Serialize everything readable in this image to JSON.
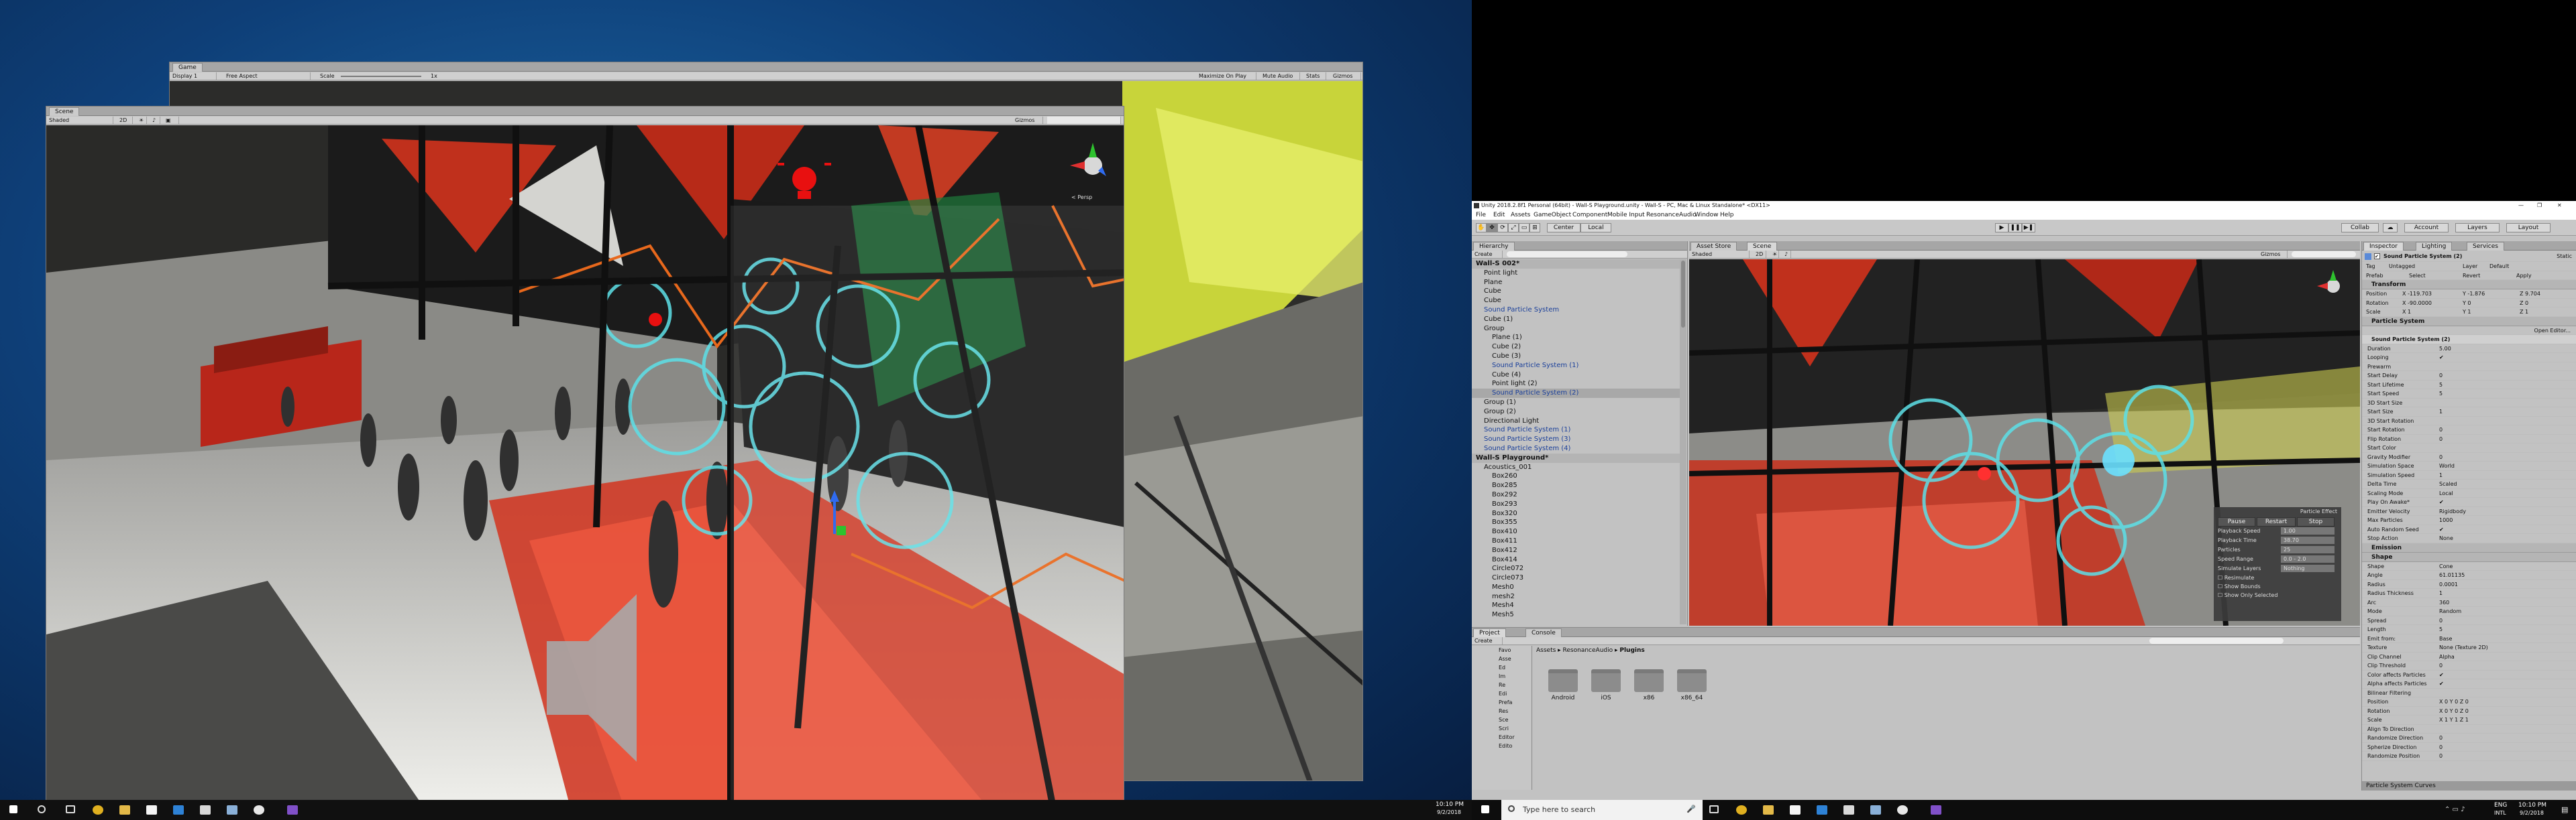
{
  "game_window": {
    "tab": "Game",
    "toolbar": {
      "display": "Display 1",
      "aspect": "Free Aspect",
      "scale_label": "Scale",
      "scale_value": "1x",
      "maximize": "Maximize On Play",
      "mute": "Mute Audio",
      "stats": "Stats",
      "gizmos": "Gizmos"
    }
  },
  "scene_window": {
    "tab": "Scene",
    "toolbar": {
      "shaded": "Shaded",
      "mode2d": "2D",
      "gizmos": "Gizmos"
    },
    "persp": "< Persp"
  },
  "unity": {
    "title": "Unity 2018.2.8f1 Personal (64bit) - Wall-S Playground.unity - Wall-S - PC, Mac & Linux Standalone* <DX11>",
    "menu": [
      "File",
      "Edit",
      "Assets",
      "GameObject",
      "Component",
      "Mobile Input",
      "ResonanceAudio",
      "Window",
      "Help"
    ],
    "toolbar": {
      "center": "Center",
      "local": "Local",
      "collab": "Collab",
      "account": "Account",
      "layers": "Layers",
      "layout": "Layout"
    },
    "hierarchy": {
      "tab": "Hierarchy",
      "create": "Create",
      "items": [
        "Wall-S 002*",
        "Point light",
        "Plane",
        "Cube",
        "Cube",
        "Sound Particle System",
        "Cube (1)",
        "Group",
        "Plane (1)",
        "Cube (2)",
        "Cube (3)",
        "Sound Particle System (1)",
        "Cube (4)",
        "Point light (2)",
        "Sound Particle System (2)",
        "Group (1)",
        "Group (2)",
        "Directional Light",
        "Sound Particle System (1)",
        "Sound Particle System (3)",
        "Sound Particle System (4)",
        "Wall-S Playground*",
        "Acoustics_001",
        "Box260",
        "Box285",
        "Box292",
        "Box293",
        "Box320",
        "Box355",
        "Box410",
        "Box411",
        "Box412",
        "Box414",
        "Circle072",
        "Circle073",
        "Mesh0",
        "mesh2",
        "Mesh4",
        "Mesh5"
      ]
    },
    "scene_tabs": [
      "Asset Store",
      "Scene"
    ],
    "scene_toolbar": {
      "shaded": "Shaded",
      "gizmos": "Gizmos"
    },
    "particle_effect": {
      "header": "Particle Effect",
      "buttons": [
        "Pause",
        "Restart",
        "Stop"
      ],
      "rows": [
        {
          "k": "Playback Speed",
          "v": "1.00"
        },
        {
          "k": "Playback Time",
          "v": "38.70"
        },
        {
          "k": "Particles",
          "v": "25"
        },
        {
          "k": "Speed Range",
          "v": "0.0 - 2.0"
        },
        {
          "k": "Simulate Layers",
          "v": "Nothing"
        }
      ],
      "checks": [
        "Resimulate",
        "Show Bounds",
        "Show Only Selected"
      ]
    },
    "project": {
      "tabs": [
        "Project",
        "Console"
      ],
      "create": "Create",
      "breadcrumb": [
        "Assets",
        "ResonanceAudio",
        "Plugins"
      ],
      "folders": [
        "Android",
        "iOS",
        "x86",
        "x86_64"
      ],
      "tree": [
        "Favo",
        "Asse",
        "Ed",
        "Im",
        "Re",
        "Edi",
        "Prefa",
        "Res",
        "Sce",
        "Scri",
        "Editor",
        "Edito"
      ]
    },
    "inspector": {
      "tabs": [
        "Inspector",
        "Lighting",
        "Services"
      ],
      "object_name": "Sound Particle System (2)",
      "static": "Static",
      "tag_label": "Tag",
      "tag": "Untagged",
      "layer_label": "Layer",
      "layer": "Default",
      "prefab": "Prefab",
      "select": "Select",
      "revert": "Revert",
      "apply": "Apply",
      "transform": {
        "header": "Transform",
        "position": "Position",
        "rotation": "Rotation",
        "scale": "Scale",
        "pos": [
          "X -119.703",
          "Y -1.876",
          "Z 9.704"
        ],
        "rot": [
          "X -90.0000",
          "Y 0",
          "Z 0"
        ],
        "scl": [
          "X 1",
          "Y 1",
          "Z 1"
        ]
      },
      "particle_system": {
        "header": "Particle System",
        "open_editor": "Open Editor...",
        "sub": "Sound Particle System (2)",
        "rows": [
          {
            "k": "Duration",
            "v": "5.00"
          },
          {
            "k": "Looping",
            "v": "✔"
          },
          {
            "k": "Prewarm",
            "v": ""
          },
          {
            "k": "Start Delay",
            "v": "0"
          },
          {
            "k": "Start Lifetime",
            "v": "5"
          },
          {
            "k": "Start Speed",
            "v": "5"
          },
          {
            "k": "3D Start Size",
            "v": ""
          },
          {
            "k": "Start Size",
            "v": "1"
          },
          {
            "k": "3D Start Rotation",
            "v": ""
          },
          {
            "k": "Start Rotation",
            "v": "0"
          },
          {
            "k": "Flip Rotation",
            "v": "0"
          },
          {
            "k": "Start Color",
            "v": ""
          },
          {
            "k": "Gravity Modifier",
            "v": "0"
          },
          {
            "k": "Simulation Space",
            "v": "World"
          },
          {
            "k": "Simulation Speed",
            "v": "1"
          },
          {
            "k": "Delta Time",
            "v": "Scaled"
          },
          {
            "k": "Scaling Mode",
            "v": "Local"
          },
          {
            "k": "Play On Awake*",
            "v": "✔"
          },
          {
            "k": "Emitter Velocity",
            "v": "Rigidbody"
          },
          {
            "k": "Max Particles",
            "v": "1000"
          },
          {
            "k": "Auto Random Seed",
            "v": "✔"
          },
          {
            "k": "Stop Action",
            "v": "None"
          }
        ]
      },
      "emission": "Emission",
      "shape": "Shape",
      "shape_rows": [
        {
          "k": "Shape",
          "v": "Cone"
        },
        {
          "k": "Angle",
          "v": "61.01135"
        },
        {
          "k": "Radius",
          "v": "0.0001"
        },
        {
          "k": "Radius Thickness",
          "v": "1"
        },
        {
          "k": "Arc",
          "v": "360"
        },
        {
          "k": "Mode",
          "v": "Random"
        },
        {
          "k": "Spread",
          "v": "0"
        },
        {
          "k": "Length",
          "v": "5"
        },
        {
          "k": "Emit from:",
          "v": "Base"
        },
        {
          "k": "Texture",
          "v": "None (Texture 2D)"
        },
        {
          "k": "Clip Channel",
          "v": "Alpha"
        },
        {
          "k": "Clip Threshold",
          "v": "0"
        },
        {
          "k": "Color affects Particles",
          "v": "✔"
        },
        {
          "k": "Alpha affects Particles",
          "v": "✔"
        },
        {
          "k": "Bilinear Filtering",
          "v": ""
        },
        {
          "k": "Position",
          "v": "X 0   Y 0   Z 0"
        },
        {
          "k": "Rotation",
          "v": "X 0   Y 0   Z 0"
        },
        {
          "k": "Scale",
          "v": "X 1   Y 1   Z 1"
        },
        {
          "k": "Align To Direction",
          "v": ""
        },
        {
          "k": "Randomize Direction",
          "v": "0"
        },
        {
          "k": "Spherize Direction",
          "v": "0"
        },
        {
          "k": "Randomize Position",
          "v": "0"
        }
      ],
      "curves": "Particle System Curves"
    }
  },
  "taskbar_left": {
    "time": "10:10 PM",
    "date": "9/2/2018"
  },
  "taskbar_right": {
    "search": "Type here to search",
    "lang": "ENG",
    "region": "INTL",
    "time": "10:10 PM",
    "date": "9/2/2018"
  },
  "colors": {
    "unity_gray": "#c2c2c2",
    "selected": "#3e7de0",
    "scene_red": "#c0301c",
    "accent_cyan": "#5de0e8"
  }
}
